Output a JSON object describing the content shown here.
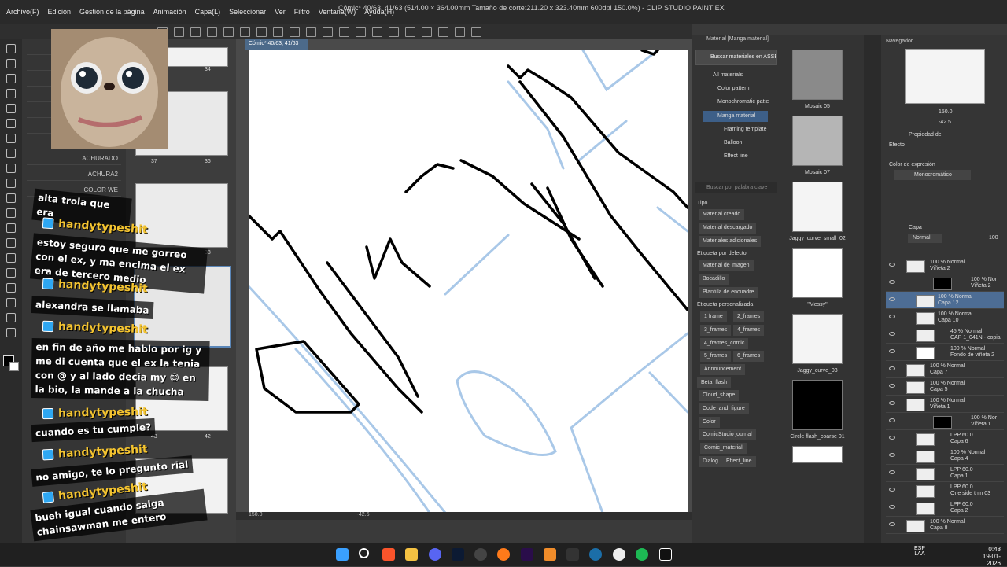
{
  "window": {
    "title": "Cómic* 40/63, 41/63 (514.00 × 364.00mm Tamaño de corte:211.20 x 323.40mm 600dpi 150.0%) - CLIP STUDIO PAINT EX"
  },
  "menu": [
    "Archivo(F)",
    "Edición",
    "Gestión de la página",
    "Animación",
    "Capa(L)",
    "Seleccionar",
    "Ver",
    "Filtro",
    "Ventana(W)",
    "Ayuda(H)"
  ],
  "doc_tab": "Cómic* 40/63, 41/63",
  "brush_labels": [
    "ACHURADO",
    "ACHURA2",
    "COLOR WE"
  ],
  "pages": {
    "nums": [
      "34",
      "37",
      "36",
      "38",
      "43",
      "42"
    ],
    "spread_label": "Ⅱ"
  },
  "status": {
    "zoom": "150.0",
    "angle": "-42.5"
  },
  "material": {
    "header": "Material [Manga material]",
    "search_label": "Buscar materiales en ASSETS",
    "tree": [
      "All materials",
      "Color pattern",
      "Monochromatic patte",
      "Manga material",
      "Framing template",
      "Balloon",
      "Effect line"
    ],
    "keyword_placeholder": "Buscar por palabra clave",
    "tipo_label": "Tipo",
    "tipo_tags": [
      "Material creado",
      "Material descargado",
      "Materiales adicionales"
    ],
    "default_label": "Etiqueta por defecto",
    "default_tags": [
      "Material de imagen",
      "Bocadillo",
      "Plantilla de encuadre"
    ],
    "custom_label": "Etiqueta personalizada",
    "custom_tags": [
      "1 frame",
      "2_frames",
      "3_frames",
      "4_frames",
      "4_frames_comic",
      "5_frames",
      "6_frames",
      "Announcement",
      "Beta_flash",
      "Cloud_shape",
      "Code_and_figure",
      "Color",
      "ComicStudio journal",
      "Comic_material",
      "Dialog",
      "Effect_line"
    ],
    "items": [
      "Mosaic 05",
      "Mosaic 07",
      "Jaggy_curve_small_02",
      "\"Messy\"",
      "Jaggy_curve_03",
      "Circle flash_coarse 01"
    ]
  },
  "navigator": {
    "title": "Navegador",
    "zoom": "150.0",
    "angle": "-42.5"
  },
  "property": {
    "title": "Propiedad de",
    "effect": "Efecto",
    "expr_label": "Color de expresión",
    "expr_value": "Monocromático"
  },
  "layer_panel": {
    "title": "Capa",
    "blend": "Normal",
    "opacity": "100",
    "layers": [
      {
        "a": "100 % Normal",
        "b": "Viñeta 2"
      },
      {
        "a": "100 % Nor",
        "b": "Viñeta 2"
      },
      {
        "a": "100 % Normal",
        "b": "Capa 12"
      },
      {
        "a": "100 % Normal",
        "b": "Capa 10"
      },
      {
        "a": "45 % Normal",
        "b": "CAP 1_041N - copia"
      },
      {
        "a": "100 % Normal",
        "b": "Fondo de viñeta 2"
      },
      {
        "a": "100 % Normal",
        "b": "Capa 7"
      },
      {
        "a": "100 % Normal",
        "b": "Capa 5"
      },
      {
        "a": "100 % Normal",
        "b": "Viñeta 1"
      },
      {
        "a": "100 % Nor",
        "b": "Viñeta 1"
      },
      {
        "a": "LPP 60.0",
        "b": "Capa 6"
      },
      {
        "a": "100 % Normal",
        "b": "Capa 4"
      },
      {
        "a": "LPP 60.0",
        "b": "Capa 1"
      },
      {
        "a": "LPP 60.0",
        "b": "One side thin 03"
      },
      {
        "a": "LPP 60.0",
        "b": "Capa 2"
      },
      {
        "a": "100 % Normal",
        "b": "Capa 8"
      }
    ]
  },
  "chat": [
    {
      "type": "msg",
      "text": "alta trola que era"
    },
    {
      "type": "user",
      "text": "handytypeshit"
    },
    {
      "type": "msg",
      "text": "estoy seguro que me gorreo con el ex, y ma encima el ex era de tercero medio"
    },
    {
      "type": "user",
      "text": "handytypeshit"
    },
    {
      "type": "msg",
      "text": "alexandra se llamaba"
    },
    {
      "type": "user",
      "text": "handytypeshit"
    },
    {
      "type": "msg",
      "text": "en fin de año me hablo por ig y me di cuenta que el ex la tenia con @ y al lado decia my 😊 en la bio, la mande a la chucha"
    },
    {
      "type": "user",
      "text": "handytypeshit"
    },
    {
      "type": "msg",
      "text": "cuando es tu cumple?"
    },
    {
      "type": "user",
      "text": "handytypeshit"
    },
    {
      "type": "msg",
      "text": "no amigo, te lo pregunto rial"
    },
    {
      "type": "user",
      "text": "handytypeshit"
    },
    {
      "type": "msg",
      "text": "bueh igual cuando salga chainsawman me entero"
    }
  ],
  "taskbar": {
    "lang1": "ESP",
    "lang2": "LAA",
    "time": "0:48",
    "date": "19-01-2026"
  },
  "colors": {
    "accent": "#3d5f88",
    "chat_user": "#f4c430",
    "sketch_blue": "#a9c8e8"
  }
}
